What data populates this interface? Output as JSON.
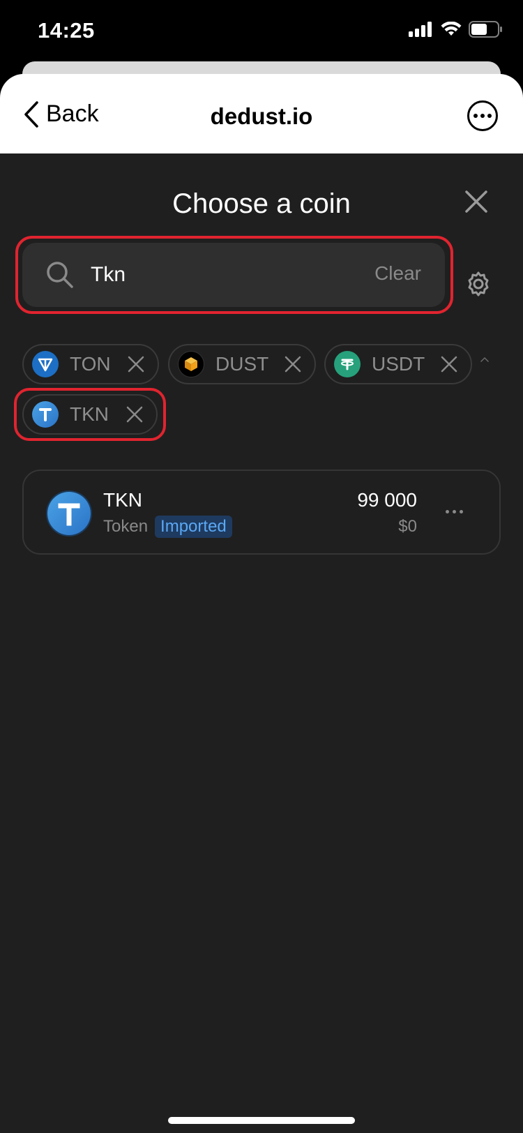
{
  "status_bar": {
    "time": "14:25"
  },
  "browser": {
    "back_label": "Back",
    "site_title": "dedust.io"
  },
  "modal": {
    "title": "Choose a coin",
    "search": {
      "value": "Tkn",
      "clear_label": "Clear"
    }
  },
  "chips": [
    {
      "symbol": "TON",
      "icon": "ton-icon",
      "color": "#0098ea"
    },
    {
      "symbol": "DUST",
      "icon": "dust-icon",
      "color": "#f4a018"
    },
    {
      "symbol": "USDT",
      "icon": "usdt-icon",
      "color": "#26a17b"
    },
    {
      "symbol": "TKN",
      "icon": "tkn-icon",
      "color": "#3b8fe0"
    }
  ],
  "token_list": [
    {
      "name": "TKN",
      "type": "Token",
      "badge": "Imported",
      "amount": "99 000",
      "usd": "$0",
      "icon": "tkn-icon"
    }
  ],
  "colors": {
    "highlight": "#e0242f",
    "background": "#1f1f1f",
    "badge_bg": "#1e3a5f",
    "badge_text": "#5aa8f5"
  }
}
